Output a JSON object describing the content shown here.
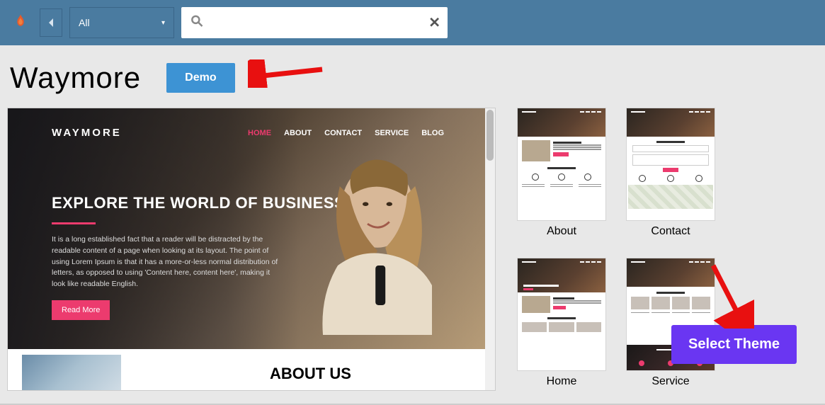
{
  "topbar": {
    "filter_label": "All",
    "search_value": ""
  },
  "page_title": "Waymore",
  "demo_label": "Demo",
  "preview": {
    "logo": "WAYMORE",
    "nav": [
      "HOME",
      "ABOUT",
      "CONTACT",
      "SERVICE",
      "BLOG"
    ],
    "headline": "EXPLORE THE WORLD OF BUSINESS",
    "paragraph": "It is a long established fact that a reader will be distracted by the readable content of a page when looking at its layout. The point of using Lorem Ipsum is that it has a more-or-less normal distribution of letters, as opposed to using 'Content here, content here', making it look like readable English.",
    "read_more": "Read More",
    "about_heading": "ABOUT US"
  },
  "thumbs": [
    {
      "label": "About"
    },
    {
      "label": "Contact"
    },
    {
      "label": "Home"
    },
    {
      "label": "Service"
    }
  ],
  "select_theme_label": "Select Theme",
  "colors": {
    "topbar": "#4a7ba0",
    "demo_btn": "#3d93d4",
    "accent_pink": "#ec3b6e",
    "select_theme": "#6a36f2",
    "arrow": "#e81010"
  }
}
